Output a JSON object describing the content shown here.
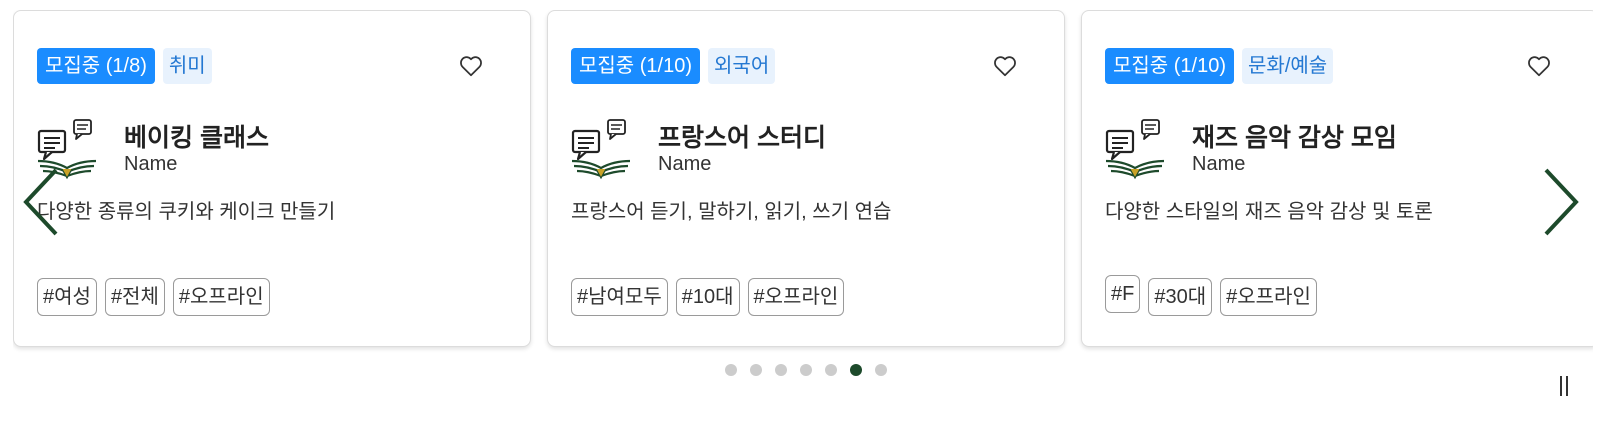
{
  "cards": [
    {
      "status": "모집중 (1/8)",
      "category": "취미",
      "title": "베이킹 클래스",
      "subtitle": "Name",
      "description": "다양한 종류의 쿠키와 케이크 만들기",
      "tags": [
        "#여성",
        "#전체",
        "#오프라인"
      ]
    },
    {
      "status": "모집중 (1/10)",
      "category": "외국어",
      "title": "프랑스어 스터디",
      "subtitle": "Name",
      "description": "프랑스어 듣기, 말하기, 읽기, 쓰기 연습",
      "tags": [
        "#남여모두",
        "#10대",
        "#오프라인"
      ]
    },
    {
      "status": "모집중 (1/10)",
      "category": "문화/예술",
      "title": "재즈 음악 감상 모임",
      "subtitle": "Name",
      "description": "다양한 스타일의 재즈 음악 감상 및 토론",
      "tags": [
        "#F",
        "#30대",
        "#오프라인"
      ]
    }
  ],
  "pagination": {
    "total": 7,
    "active_index": 5
  },
  "colors": {
    "status_badge": "#1a8cff",
    "category_text": "#2478d2",
    "category_bg": "#e8f2fd",
    "accent_dark_green": "#1d4a2b",
    "dot_inactive": "#cccccc"
  },
  "icons": {
    "favorite": "heart-outline-icon",
    "group_logo": "chat-bubbles-wings-icon",
    "prev": "chevron-left-icon",
    "next": "chevron-right-icon",
    "autoplay": "pause-icon"
  }
}
